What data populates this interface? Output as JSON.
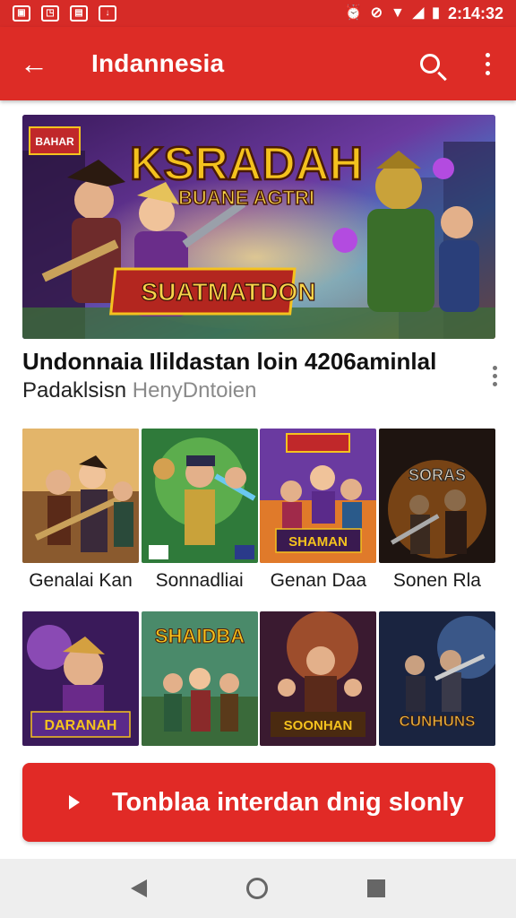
{
  "status_bar": {
    "left_icons": [
      "image-icon",
      "screenshot-icon",
      "news-icon",
      "download-icon"
    ],
    "right_icons": [
      "alarm-icon",
      "dnd-icon",
      "wifi-icon",
      "signal-icon",
      "battery-icon"
    ],
    "time": "2:14:32"
  },
  "app_bar": {
    "title": "Indannesia",
    "icons": [
      "back-arrow-icon",
      "search-icon",
      "more-vertical-icon"
    ]
  },
  "hero": {
    "badge": "BAHAR",
    "title": "KSRADAH",
    "subtitle": "BUANE AGTRI",
    "banner": "SUATMATDON",
    "colors": {
      "title": "#f4c21e",
      "sky": "#2f7fc6",
      "purple": "#5d2d83"
    }
  },
  "headline": {
    "line1": "Undonnaia Ilildastan loin 4206aminlal",
    "line2_main": "Padaklsisn",
    "line2_muted": "HenyDntoien"
  },
  "grid": {
    "row1": [
      {
        "caption": "Genalai Kan",
        "art": ""
      },
      {
        "caption": "Sonnadliai",
        "art": ""
      },
      {
        "caption": "Genan Daa",
        "art": "SHAMAN"
      },
      {
        "caption": "Sonen Rla",
        "art": "SORAS"
      }
    ],
    "row2": [
      {
        "caption": "",
        "art": "DARANAH"
      },
      {
        "caption": "",
        "art": "SHAIDBA"
      },
      {
        "caption": "",
        "art": "SOONHAN"
      },
      {
        "caption": "",
        "art": "CUNHUNS"
      }
    ]
  },
  "cta": {
    "label": "Tonblaa interdan dnig slonly",
    "icon": "play-icon",
    "color": "#e12a26"
  },
  "nav": {
    "icons": [
      "nav-back-icon",
      "nav-home-icon",
      "nav-recent-icon"
    ]
  },
  "theme": {
    "primary": "#dd2c26"
  }
}
